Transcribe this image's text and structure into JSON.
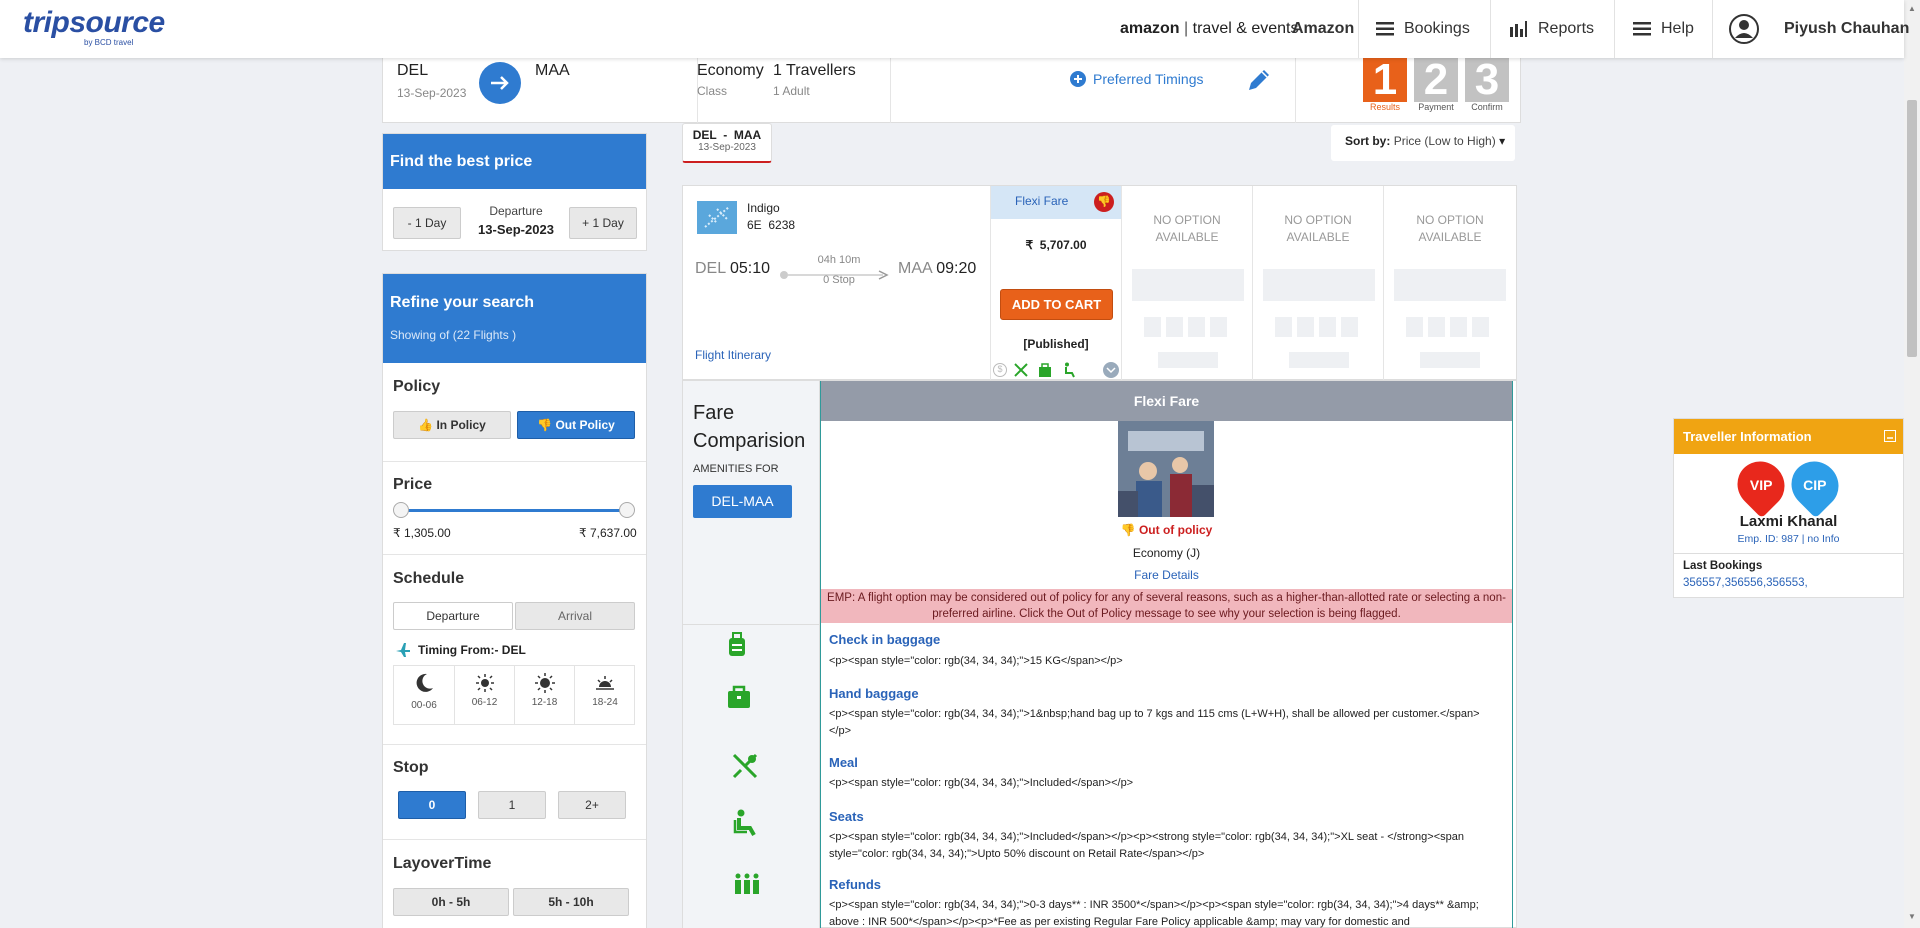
{
  "header": {
    "logo_main": "tripsource",
    "logo_sub": "by BCD travel",
    "brand_a": "amazon",
    "brand_b": "travel & events",
    "company": "Amazon",
    "nav": {
      "bookings": "Bookings",
      "reports": "Reports",
      "help": "Help"
    },
    "user": "Piyush Chauhan"
  },
  "search": {
    "from": "DEL",
    "from_date": "13-Sep-2023",
    "to": "MAA",
    "cabin": "Economy",
    "cabin_label": "Class",
    "travellers": "1 Travellers",
    "travellers_detail": "1 Adult",
    "preferred_timings": "Preferred Timings",
    "steps": [
      {
        "num": "1",
        "label": "Results"
      },
      {
        "num": "2",
        "label": "Payment"
      },
      {
        "num": "3",
        "label": "Confirm"
      }
    ]
  },
  "route_tab": {
    "route": "DEL  -  MAA",
    "date": "13-Sep-2023"
  },
  "sort": {
    "label": "Sort by:",
    "value": "Price (Low to High)"
  },
  "best_price": {
    "title": "Find the best price",
    "minus": "- 1 Day",
    "plus": "+ 1 Day",
    "dep_label": "Departure",
    "dep_date": "13-Sep-2023"
  },
  "refine": {
    "title": "Refine your search",
    "showing": "Showing of (22 Flights )",
    "policy": {
      "title": "Policy",
      "in": "In Policy",
      "out": "Out Policy"
    },
    "price": {
      "title": "Price",
      "min": "₹ 1,305.00",
      "max": "₹ 7,637.00"
    },
    "schedule": {
      "title": "Schedule",
      "tab_dep": "Departure",
      "tab_arr": "Arrival",
      "timing_from": "Timing From:- DEL",
      "slots": [
        "00-06",
        "06-12",
        "12-18",
        "18-24"
      ]
    },
    "stop": {
      "title": "Stop",
      "options": [
        "0",
        "1",
        "2+"
      ]
    },
    "layover": {
      "title": "LayoverTime",
      "options": [
        "0h - 5h",
        "5h - 10h"
      ]
    }
  },
  "flight": {
    "airline": "Indigo",
    "code": "6E  6238",
    "dep_code": "DEL",
    "dep_time": "05:10",
    "duration": "04h 10m",
    "stops": "0 Stop",
    "arr_code": "MAA",
    "arr_time": "09:20",
    "itinerary": "Flight Itinerary",
    "fare_name": "Flexi Fare",
    "price": "₹  5,707.00",
    "add_to_cart": "ADD TO CART",
    "published": "[Published]",
    "no_option": "NO OPTION AVAILABLE"
  },
  "comparison": {
    "title_1": "Fare",
    "title_2": "Comparision",
    "amenities_for": "AMENITIES FOR",
    "route_btn": "DEL-MAA",
    "column_title": "Flexi Fare",
    "policy_flag": "Out of policy",
    "cabin": "Economy (J)",
    "fare_details": "Fare Details",
    "policy_message": "EMP: A flight option may be considered out of policy for any of several reasons, such as a higher-than-allotted rate or selecting a non-preferred airline. Click the Out of Policy message to see why your selection is being flagged.",
    "amenities": [
      {
        "title": "Check in baggage",
        "desc": "<p><span style=\"color: rgb(34, 34, 34);\">15 KG</span></p>"
      },
      {
        "title": "Hand baggage",
        "desc": "<p><span style=\"color: rgb(34, 34, 34);\">1&nbsp;hand bag up to 7 kgs and 115 cms (L+W+H), shall be allowed per customer.</span></p>"
      },
      {
        "title": "Meal",
        "desc": "<p><span style=\"color: rgb(34, 34, 34);\">Included</span></p>"
      },
      {
        "title": "Seats",
        "desc": "<p><span style=\"color: rgb(34, 34, 34);\">Included</span></p><p><strong style=\"color: rgb(34, 34, 34);\">XL seat - </strong><span style=\"color: rgb(34, 34, 34);\">Upto 50% discount on Retail Rate</span></p>"
      },
      {
        "title": "Refunds",
        "desc": "<p><span style=\"color: rgb(34, 34, 34);\">0-3 days** : INR 3500*</span></p><p><span style=\"color: rgb(34, 34, 34);\">4 days** &amp; above : INR 500*</span></p><p>*Fee as per existing Regular Fare Policy applicable &amp; may vary for domestic and"
      }
    ]
  },
  "traveller": {
    "title": "Traveller Information",
    "badges": [
      "VIP",
      "CIP"
    ],
    "name": "Laxmi Khanal",
    "emp": "Emp. ID: 987 | no Info",
    "last_bookings_label": "Last Bookings",
    "last_bookings": "356557,356556,356553,"
  },
  "colors": {
    "primary": "#2f7bd0",
    "orange": "#e8611a",
    "out_policy": "#cc1f1f",
    "amenity_green": "#2aa52a",
    "traveller_header": "#f0a412"
  }
}
